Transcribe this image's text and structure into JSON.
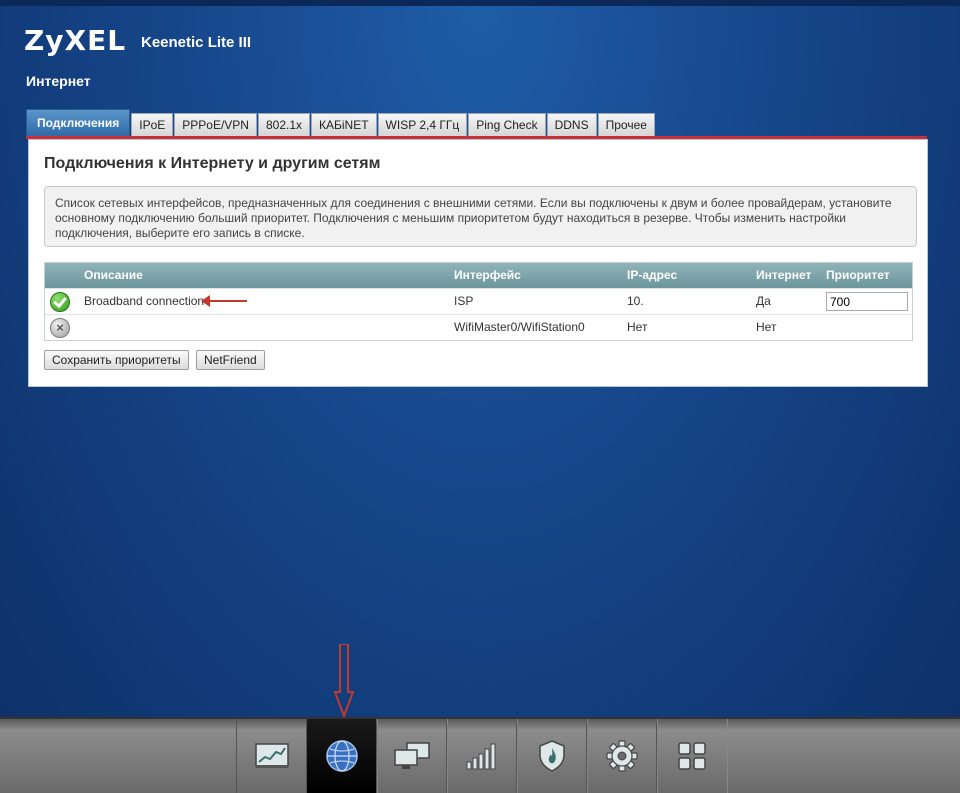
{
  "header": {
    "logo": "ZyXEL",
    "model": "Keenetic Lite III",
    "section": "Интернет"
  },
  "tabs": [
    {
      "label": "Подключения",
      "active": true
    },
    {
      "label": "IPoE"
    },
    {
      "label": "PPPoE/VPN"
    },
    {
      "label": "802.1x"
    },
    {
      "label": "КАБiNET"
    },
    {
      "label": "WISP 2,4 ГГц"
    },
    {
      "label": "Ping Check"
    },
    {
      "label": "DDNS"
    },
    {
      "label": "Прочее"
    }
  ],
  "panel": {
    "title": "Подключения к Интернету и другим сетям",
    "info": "Список сетевых интерфейсов, предназначенных для соединения с внешними сетями. Если вы подключены к двум и более провайдерам, установите основному подключению больший приоритет. Подключения с меньшим приоритетом будут находиться в резерве. Чтобы изменить настройки подключения, выберите его запись в списке."
  },
  "table": {
    "headers": {
      "desc": "Описание",
      "iface": "Интерфейс",
      "ip": "IP-адрес",
      "inet": "Интернет",
      "prio": "Приоритет"
    },
    "rows": [
      {
        "status": "check-icon",
        "desc": "Broadband connection",
        "iface": "ISP",
        "ip": "10.",
        "inet": "Да",
        "prio": "700"
      },
      {
        "status": "x-icon",
        "desc": "",
        "iface": "WifiMaster0/WifiStation0",
        "ip": "Нет",
        "inet": "Нет",
        "prio": ""
      }
    ]
  },
  "buttons": {
    "save": "Сохранить приоритеты",
    "netfriend": "NetFriend"
  },
  "nav": [
    {
      "icon": "monitor-chart-icon"
    },
    {
      "icon": "globe-icon",
      "active": true
    },
    {
      "icon": "network-computers-icon"
    },
    {
      "icon": "signal-bars-icon"
    },
    {
      "icon": "shield-icon"
    },
    {
      "icon": "gear-icon"
    },
    {
      "icon": "apps-grid-icon"
    }
  ],
  "colors": {
    "accent": "#2f6aa8",
    "alert_red": "#c92f36",
    "background": "#16468a"
  }
}
